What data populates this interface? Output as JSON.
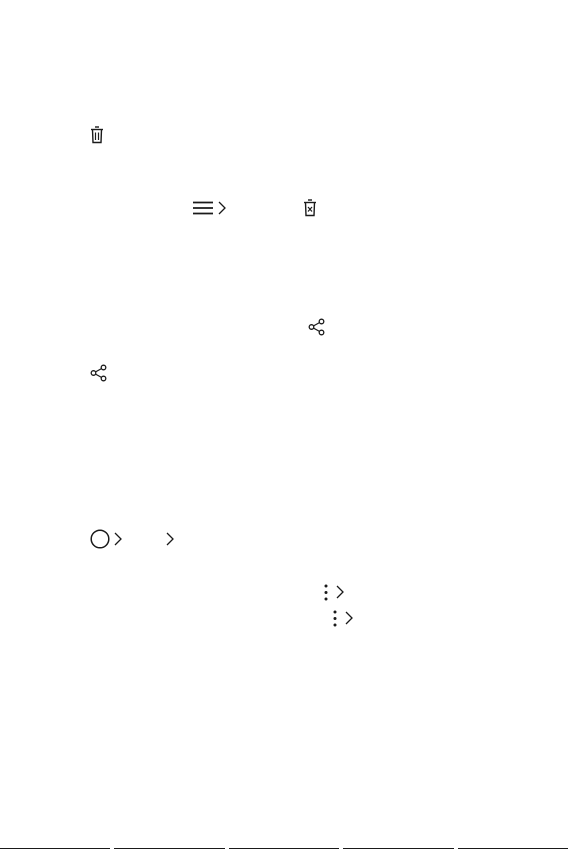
{
  "page": {
    "background": "#ffffff",
    "ink": "#1a1a1a"
  },
  "icons": [
    {
      "name": "trash-icon"
    },
    {
      "name": "menu-icon"
    },
    {
      "name": "chevron-right-icon"
    },
    {
      "name": "trash-x-icon"
    },
    {
      "name": "share-icon"
    },
    {
      "name": "share-icon"
    },
    {
      "name": "home-circle-icon"
    },
    {
      "name": "chevron-right-icon"
    },
    {
      "name": "chevron-right-icon"
    },
    {
      "name": "more-vertical-icon"
    },
    {
      "name": "chevron-right-icon"
    },
    {
      "name": "more-vertical-icon"
    },
    {
      "name": "chevron-right-icon"
    }
  ]
}
